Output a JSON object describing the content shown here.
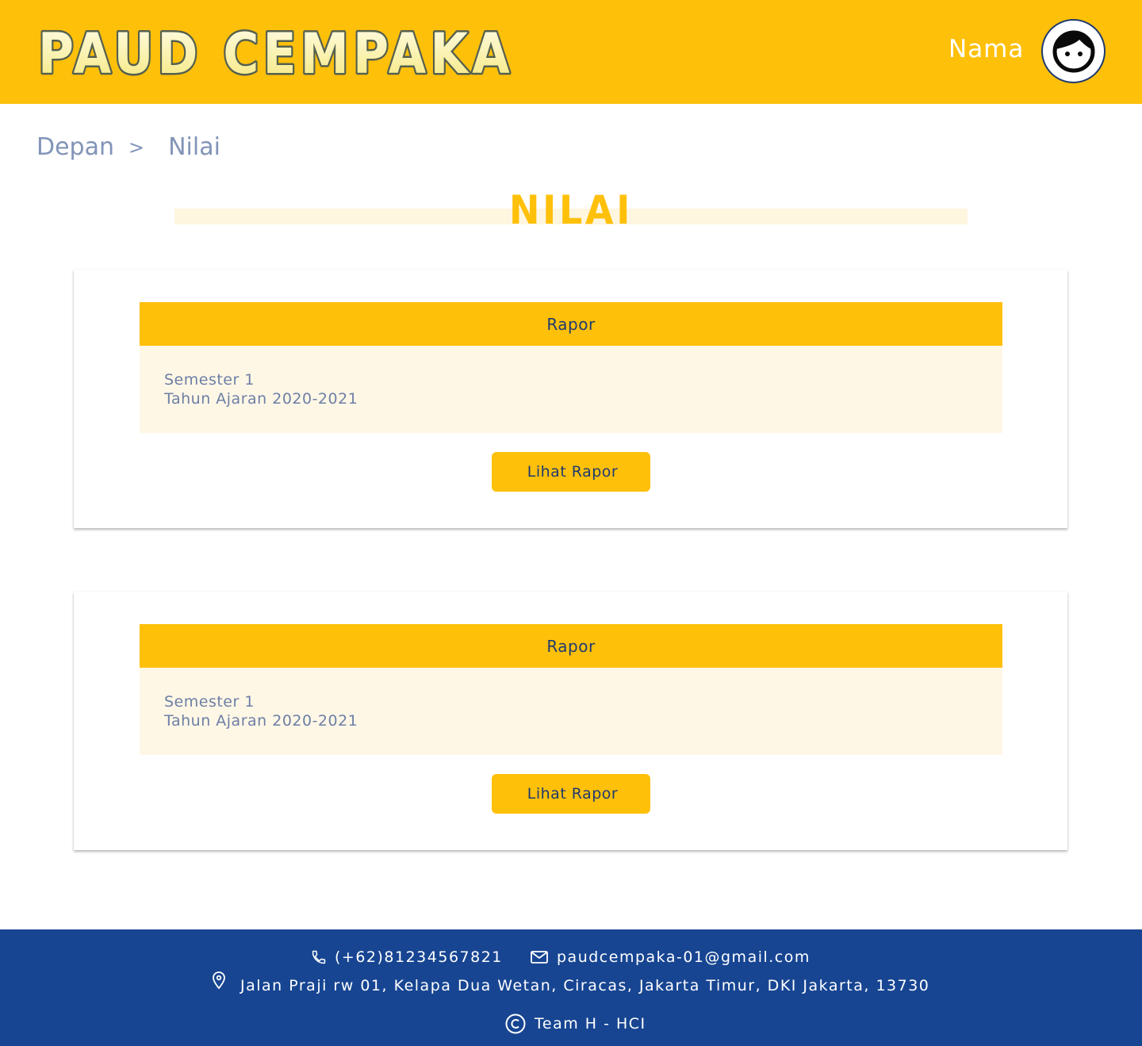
{
  "header": {
    "logo_text": "PAUD CEMPAKA",
    "user_name": "Nama"
  },
  "breadcrumb": {
    "home": "Depan",
    "separator": ">",
    "current": "Nilai"
  },
  "page": {
    "title": "NILAI"
  },
  "cards": [
    {
      "header": "Rapor",
      "semester": "Semester 1",
      "academic_year": "Tahun Ajaran 2020-2021",
      "button_label": "Lihat Rapor"
    },
    {
      "header": "Rapor",
      "semester": "Semester 1",
      "academic_year": "Tahun Ajaran 2020-2021",
      "button_label": "Lihat Rapor"
    }
  ],
  "footer": {
    "phone": "(+62)81234567821",
    "email": "paudcempaka-01@gmail.com",
    "address": "Jalan Praji rw 01, Kelapa Dua Wetan, Ciracas, Jakarta Timur, DKI Jakarta, 13730",
    "copyright": "Team H - HCI",
    "icons": [
      "phone-icon",
      "mail-icon",
      "location-pin-icon",
      "copyright-icon"
    ]
  },
  "colors": {
    "primary_yellow": "#ffc00a",
    "navy": "#1f3a6e",
    "footer_blue": "#174592",
    "card_body": "#fff7e6",
    "breadcrumb_text": "#8294b8",
    "logo_fill": "#fdf6a8",
    "logo_outline": "#55604f"
  }
}
